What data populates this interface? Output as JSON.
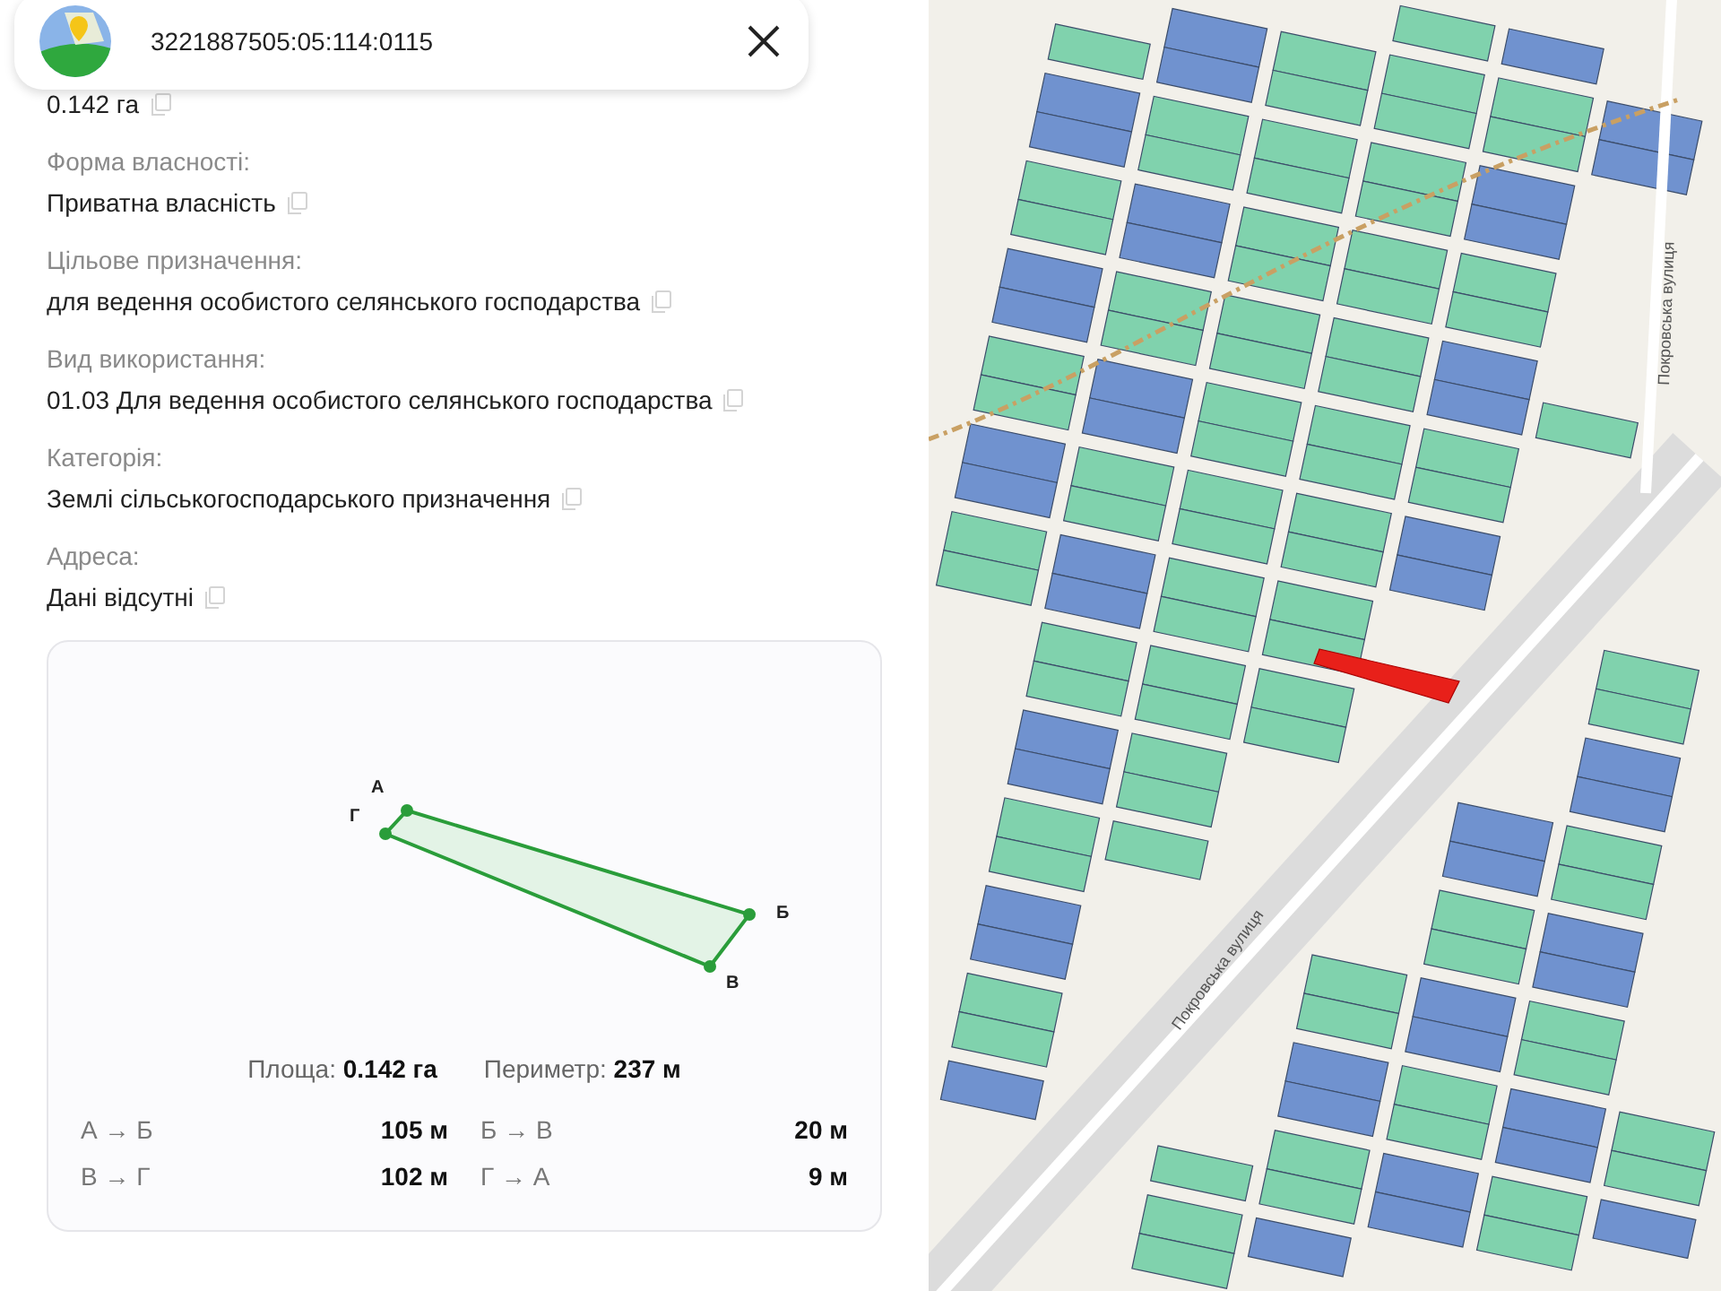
{
  "header": {
    "title": "3221887505:05:114:0115"
  },
  "area_value": "0.142 га",
  "fields": [
    {
      "label": "Форма власності:",
      "value": "Приватна власність"
    },
    {
      "label": "Цільове призначення:",
      "value": "для ведення особистого селянського господарства"
    },
    {
      "label": "Вид використання:",
      "value": "01.03 Для ведення особистого селянського господарства"
    },
    {
      "label": "Категорія:",
      "value": "Землі сільськогосподарського призначення"
    },
    {
      "label": "Адреса:",
      "value": "Дані відсутні"
    }
  ],
  "shape_card": {
    "vertices": [
      {
        "label": "А"
      },
      {
        "label": "Б"
      },
      {
        "label": "В"
      },
      {
        "label": "Г"
      }
    ],
    "summary": [
      {
        "label": "Площа:",
        "value": "0.142 га"
      },
      {
        "label": "Периметр:",
        "value": "237 м"
      }
    ],
    "sides": [
      {
        "label": "А → Б",
        "value": "105 м"
      },
      {
        "label": "Б → В",
        "value": "20 м"
      },
      {
        "label": "В → Г",
        "value": "102 м"
      },
      {
        "label": "Г → А",
        "value": "9 м"
      }
    ]
  },
  "map": {
    "street_labels": [
      "Покровська вулиця",
      "Покровська вулиця"
    ]
  }
}
